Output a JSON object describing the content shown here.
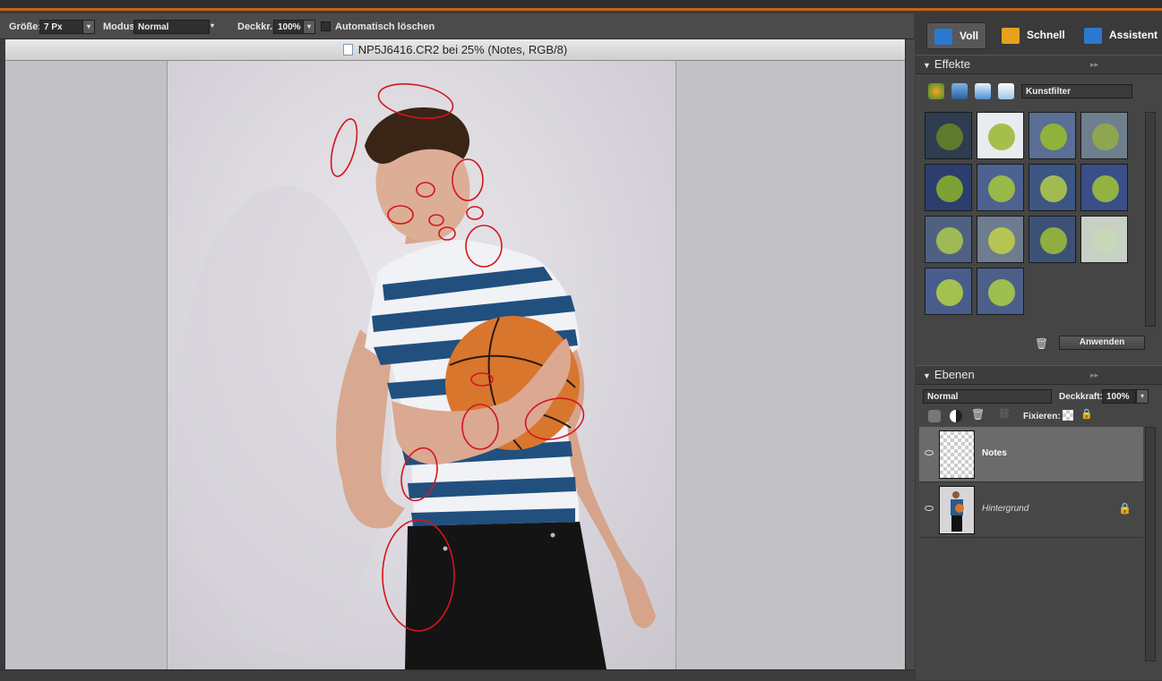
{
  "options_bar": {
    "size_label": "Größe:",
    "size_value": "7 Px",
    "mode_label": "Modus:",
    "mode_value": "Normal",
    "opacity_label": "Deckkr.:",
    "opacity_value": "100%",
    "auto_erase_label": "Automatisch löschen"
  },
  "document": {
    "title": "NP5J6416.CR2 bei 25% (Notes, RGB/8)"
  },
  "mode_tabs": [
    {
      "label": "Voll"
    },
    {
      "label": "Schnell"
    },
    {
      "label": "Assistent"
    }
  ],
  "effects_panel": {
    "title": "Effekte",
    "filter_dropdown": "Kunstfilter",
    "apply_button": "Anwenden"
  },
  "layers_panel": {
    "title": "Ebenen",
    "blend_mode": "Normal",
    "opacity_label": "Deckkraft:",
    "opacity_value": "100%",
    "lock_label": "Fixieren:",
    "layers": [
      {
        "name": "Notes"
      },
      {
        "name": "Hintergrund"
      }
    ]
  },
  "colors": {
    "accent_orange": "#c3660f",
    "annotation_red": "#d4151e",
    "selected_layer": "#6b6b6b"
  }
}
